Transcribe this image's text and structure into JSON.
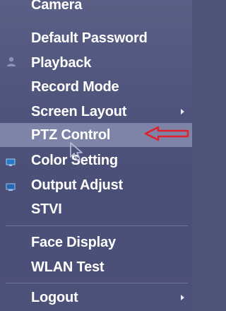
{
  "menu": {
    "items": [
      {
        "label": "Camera"
      },
      {
        "label": "Default Password"
      },
      {
        "label": "Playback"
      },
      {
        "label": "Record Mode"
      },
      {
        "label": "Screen Layout"
      },
      {
        "label": "PTZ Control"
      },
      {
        "label": "Color Setting"
      },
      {
        "label": "Output Adjust"
      },
      {
        "label": "STVI"
      },
      {
        "label": "Face Display"
      },
      {
        "label": "WLAN Test"
      },
      {
        "label": "Logout"
      }
    ],
    "selected": "PTZ Control"
  },
  "colors": {
    "menu_bg": "#4e5378",
    "selected_bg": "#7e84a8",
    "text": "#ffffff",
    "annotation": "#e0202a"
  },
  "icons": {
    "playback": "person-icon",
    "color_setting": "monitor-icon",
    "output_adjust": "display-icon",
    "submenu": "chevron-right-icon",
    "annotation": "red-arrow-icon",
    "cursor": "mouse-pointer-icon"
  }
}
